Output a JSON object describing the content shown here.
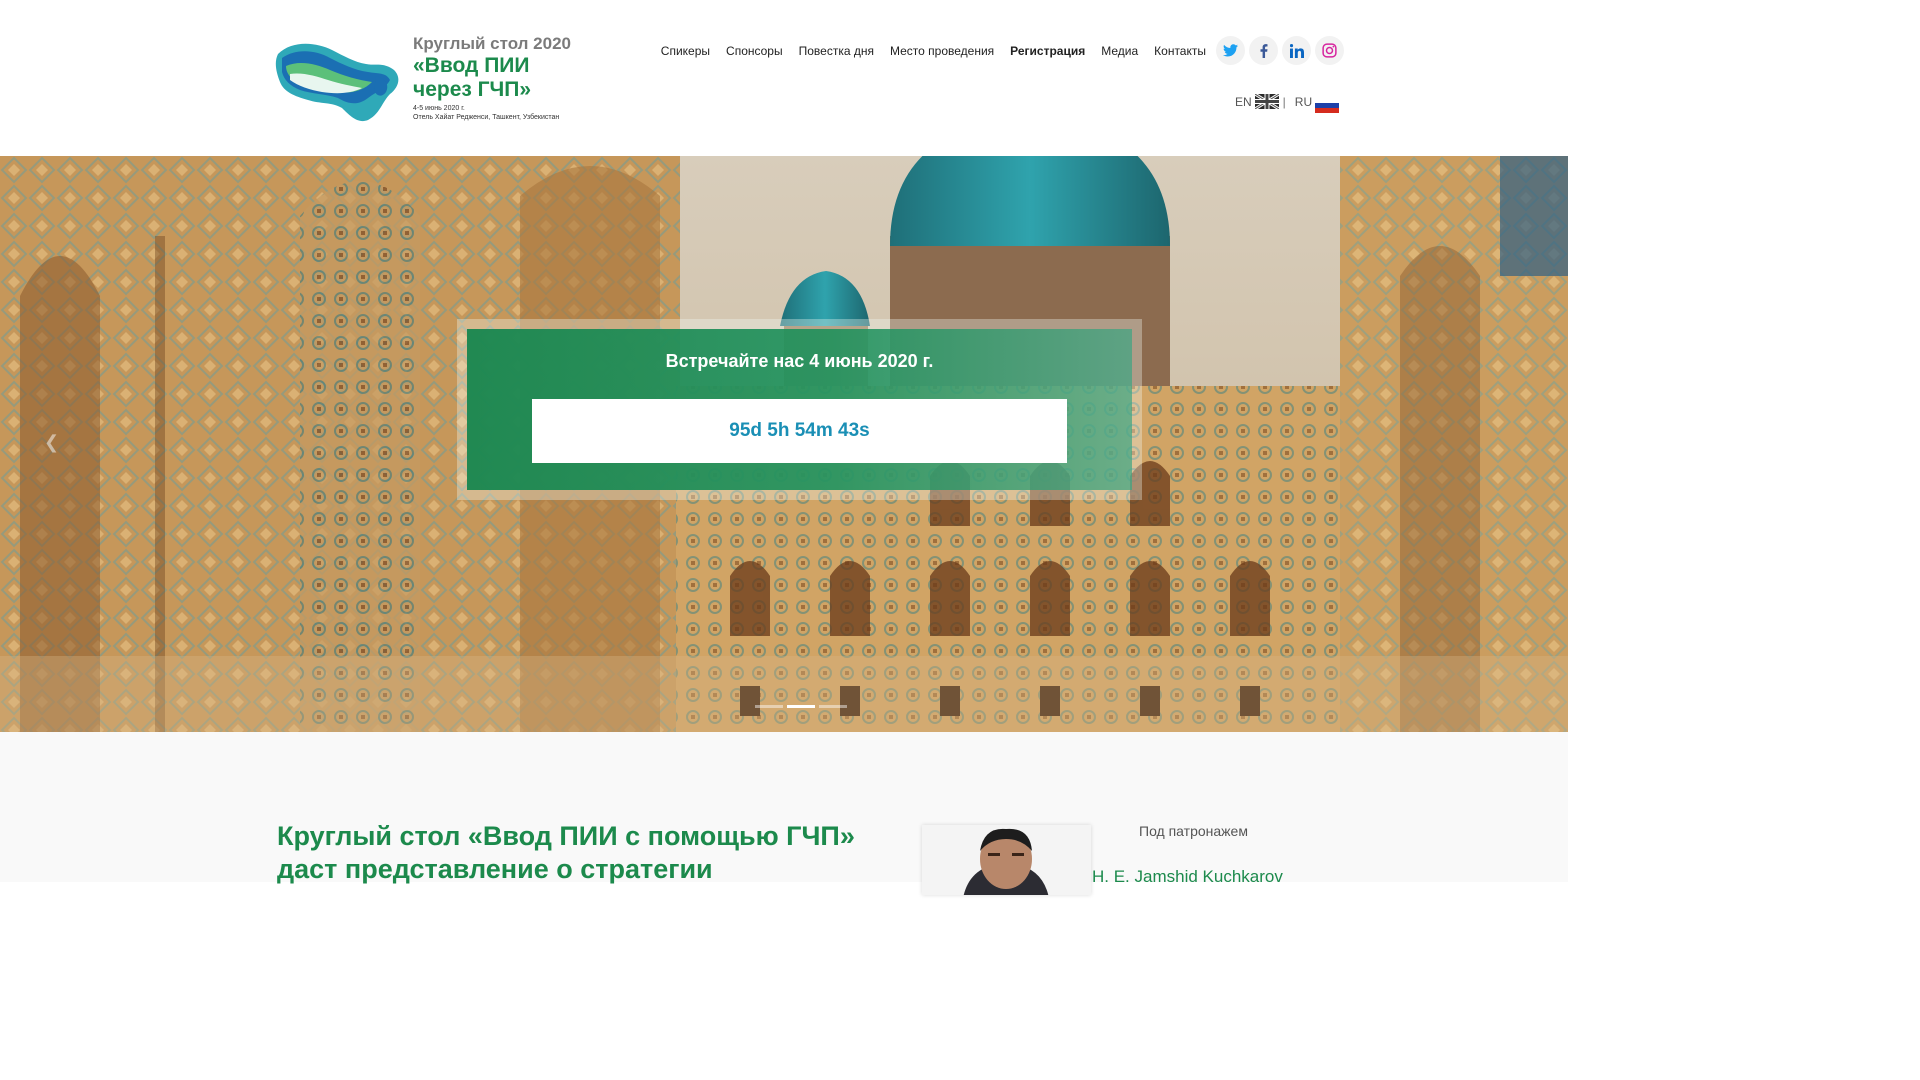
{
  "logo": {
    "kicker": "Круглый стол 2020",
    "title_line1": "«Ввод ПИИ",
    "title_line2": "через ГЧП»",
    "date": "4-5 июнь 2020 г.",
    "venue": "Отель Хайат Редженси, Ташкент, Узбекистан"
  },
  "nav": {
    "items": [
      "Спикеры",
      "Спонсоры",
      "Повестка дня",
      "Место проведения",
      "Регистрация",
      "Медиа",
      "Контакты"
    ],
    "active": "Регистрация"
  },
  "social": [
    "twitter-icon",
    "facebook-icon",
    "linkedin-icon",
    "instagram-icon"
  ],
  "lang": {
    "en": "EN",
    "ru": "RU",
    "separator": "|"
  },
  "hero": {
    "headline": "Встречайте нас 4 июнь 2020 г.",
    "countdown": "95d 5h 54m 43s",
    "slides": 3,
    "active_slide": 2
  },
  "intro": {
    "title": "Круглый стол «Ввод ПИИ с помощью ГЧП» даст представление о стратегии",
    "patron_label": "Под патронажем",
    "patron_name": "H. E. Jamshid Kuchkarov"
  },
  "colors": {
    "brand_green": "#1c8a4c",
    "timer_blue": "#1a8fb5"
  }
}
